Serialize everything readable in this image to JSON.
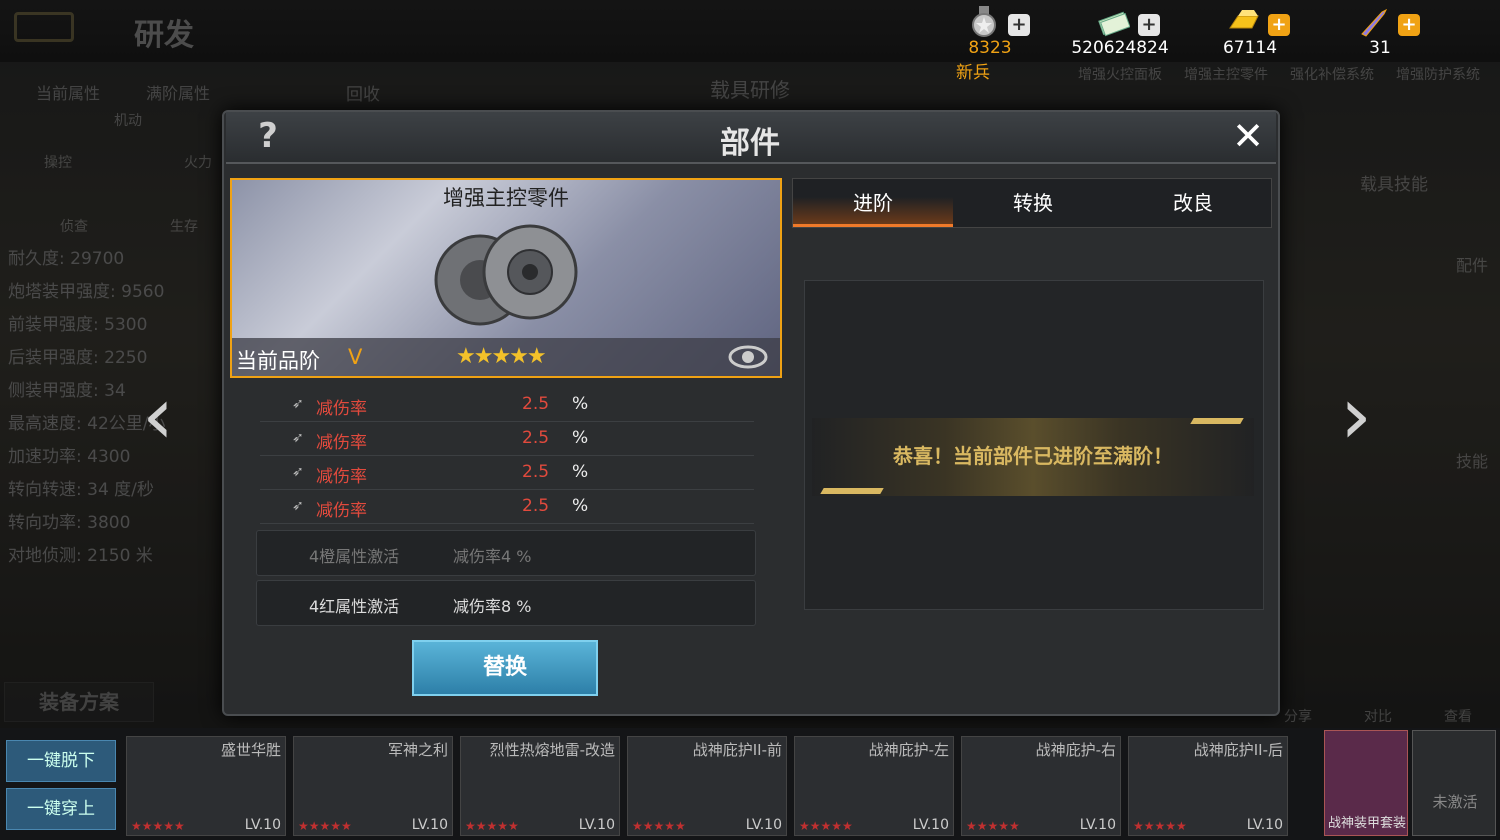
{
  "header": {
    "title": "研发",
    "rank": "新兵"
  },
  "currency": [
    {
      "icon": "medal-icon",
      "value": "8323"
    },
    {
      "icon": "cash-icon",
      "value": "520624824"
    },
    {
      "icon": "gold-icon",
      "value": "67114"
    },
    {
      "icon": "rocket-icon",
      "value": "31"
    }
  ],
  "background": {
    "tabs": [
      "当前属性",
      "满阶属性",
      "回收",
      "载具研修"
    ],
    "radar": [
      "机动",
      "操控",
      "火力",
      "侦查",
      "生存"
    ],
    "stats": [
      "耐久度: 29700",
      "炮塔装甲强度: 9560",
      "前装甲强度: 5300",
      "后装甲强度: 2250",
      "侧装甲强度: 34",
      "最高速度: 42公里/小",
      "加速功率: 4300",
      "转向转速: 34 度/秒",
      "转向功率: 3800",
      "对地侦测: 2150 米"
    ],
    "plan_label": "装备方案",
    "unequip": "一键脱下",
    "equip": "一键穿上",
    "right_parts": [
      "增强火控面板",
      "增强主控零件",
      "强化补偿系统",
      "增强防护系统"
    ],
    "skills_label": "载具技能",
    "side_labels": [
      "配件",
      "技能"
    ],
    "tool_labels": [
      "分享",
      "对比",
      "查看"
    ],
    "slots": [
      {
        "name": "盛世华胜",
        "lv": "LV.10"
      },
      {
        "name": "军神之利",
        "lv": "LV.10"
      },
      {
        "name": "烈性热熔地雷-改造",
        "lv": "LV.10"
      },
      {
        "name": "战神庇护II-前",
        "lv": "LV.10"
      },
      {
        "name": "战神庇护-左",
        "lv": "LV.10"
      },
      {
        "name": "战神庇护-右",
        "lv": "LV.10"
      },
      {
        "name": "战神庇护II-后",
        "lv": "LV.10"
      }
    ],
    "suit": "战神装甲套装",
    "inactive": "未激活"
  },
  "modal": {
    "title": "部件",
    "part_name": "增强主控零件",
    "quality_label": "当前品阶",
    "quality_value": "V",
    "stars": "★★★★★",
    "stats": [
      {
        "name": "减伤率",
        "value": "2.5",
        "unit": "%"
      },
      {
        "name": "减伤率",
        "value": "2.5",
        "unit": "%"
      },
      {
        "name": "减伤率",
        "value": "2.5",
        "unit": "%"
      },
      {
        "name": "减伤率",
        "value": "2.5",
        "unit": "%"
      }
    ],
    "sets": [
      {
        "a": "4橙属性激活",
        "b": "减伤率4 %",
        "active": false
      },
      {
        "a": "4红属性激活",
        "b": "减伤率8 %",
        "active": true
      }
    ],
    "replace_label": "替换",
    "tabs": [
      "进阶",
      "转换",
      "改良"
    ],
    "banner": "恭喜！当前部件已进阶至满阶！"
  },
  "colors": {
    "accent": "#f0a214",
    "stat_red": "#e24a3d",
    "button_blue": "#3a94c0"
  }
}
